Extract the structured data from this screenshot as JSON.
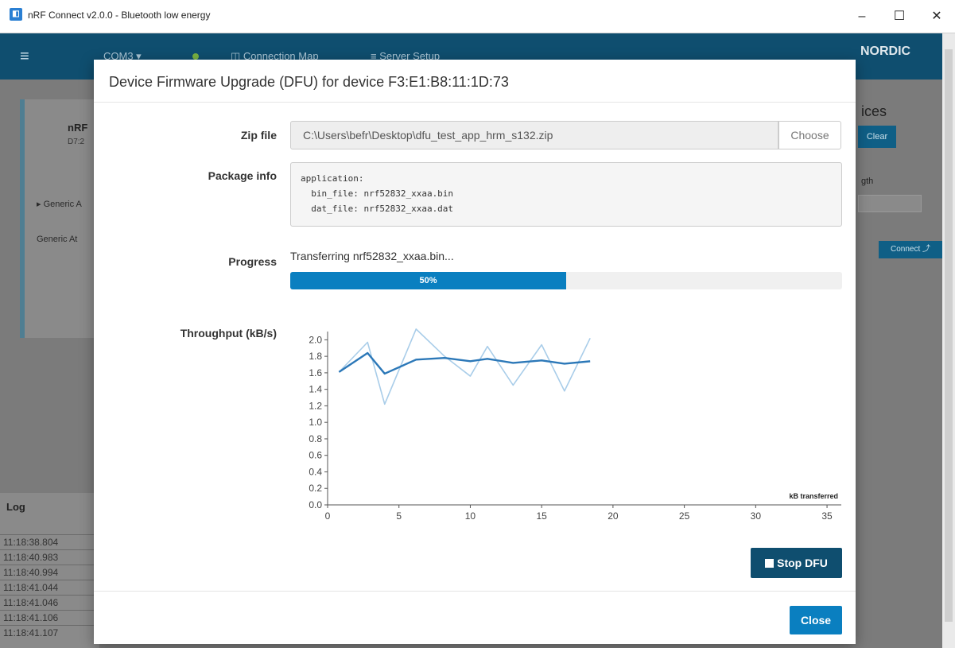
{
  "window": {
    "title": "nRF Connect v2.0.0 - Bluetooth low energy",
    "minimize": "–",
    "maximize": "☐",
    "close": "✕"
  },
  "appbar": {
    "port": "COM3 ▾",
    "connection_map": "◫ Connection Map",
    "server_setup": "≡ Server Setup",
    "logo": "NORDIC"
  },
  "background": {
    "device_name": "nRF",
    "device_address": "D7:2",
    "services": [
      "▸ Generic A",
      "Generic At"
    ],
    "right_heading": "ices",
    "clear": "Clear",
    "right_label": "gth",
    "connect": "Connect ⤴"
  },
  "log": {
    "title": "Log",
    "entries": [
      "11:18:38.804",
      "11:18:40.983",
      "11:18:40.994",
      "11:18:41.044",
      "11:18:41.046",
      "11:18:41.106",
      "11:18:41.107"
    ]
  },
  "modal": {
    "title": "Device Firmware Upgrade (DFU) for device F3:E1:B8:11:1D:73",
    "zip_label": "Zip file",
    "zip_path": "C:\\Users\\befr\\Desktop\\dfu_test_app_hrm_s132.zip",
    "choose": "Choose",
    "package_label": "Package info",
    "package_info": "application:\n  bin_file: nrf52832_xxaa.bin\n  dat_file: nrf52832_xxaa.dat",
    "progress_label": "Progress",
    "progress_status": "Transferring nrf52832_xxaa.bin...",
    "progress_value": 0.5,
    "progress_text": "50%",
    "throughput_label": "Throughput (kB/s)",
    "stop": "Stop DFU",
    "close": "Close"
  },
  "colors": {
    "accent": "#0a7fc0",
    "header": "#0f4e6f",
    "line_avg": "#2c78b8",
    "line_raw": "#a9cde9"
  },
  "chart_data": {
    "type": "line",
    "xlabel": "kB transferred",
    "ylabel": "",
    "xlim": [
      0,
      36
    ],
    "ylim": [
      0,
      2.1
    ],
    "x_ticks": [
      0,
      5,
      10,
      15,
      20,
      25,
      30,
      35
    ],
    "y_ticks": [
      0.0,
      0.2,
      0.4,
      0.6,
      0.8,
      1.0,
      1.2,
      1.4,
      1.6,
      1.8,
      2.0
    ],
    "series": [
      {
        "x": [
          0.8,
          2.8,
          4.0,
          6.2,
          8.2,
          10.0,
          11.2,
          13.0,
          15.0,
          16.6,
          18.4
        ],
        "y": [
          1.61,
          1.97,
          1.22,
          2.13,
          1.8,
          1.56,
          1.92,
          1.45,
          1.94,
          1.38,
          2.02
        ]
      },
      {
        "x": [
          0.8,
          2.8,
          4.0,
          6.2,
          8.2,
          10.0,
          11.2,
          13.0,
          15.0,
          16.6,
          18.4
        ],
        "y": [
          1.61,
          1.84,
          1.59,
          1.76,
          1.78,
          1.74,
          1.77,
          1.72,
          1.75,
          1.71,
          1.74
        ]
      }
    ]
  }
}
